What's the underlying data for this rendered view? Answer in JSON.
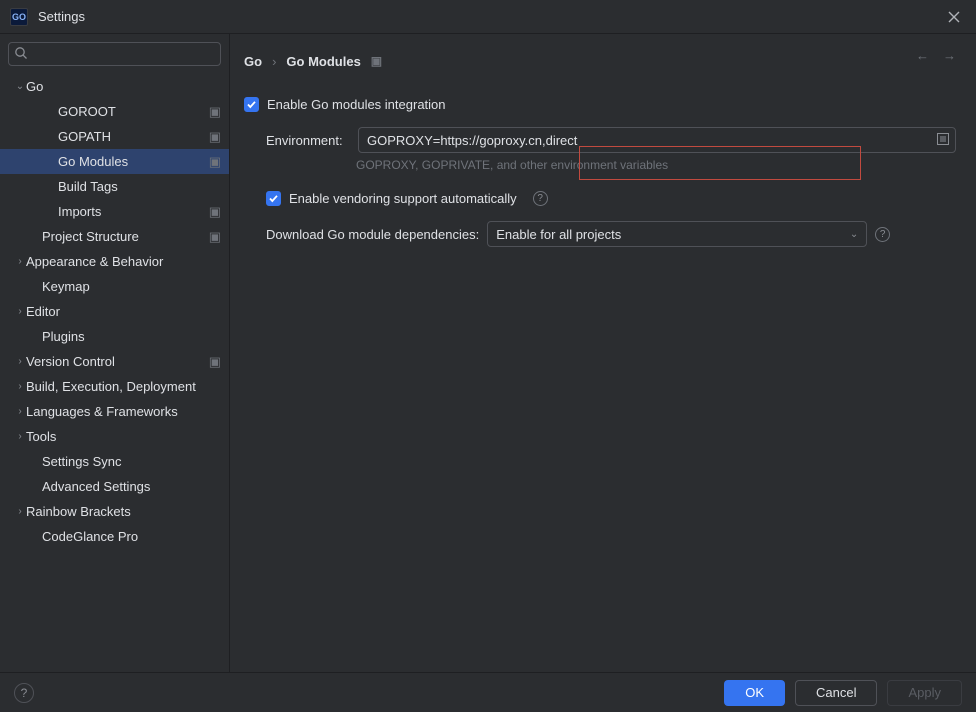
{
  "window": {
    "title": "Settings",
    "app_icon_text": "GO"
  },
  "search": {
    "placeholder": "",
    "value": ""
  },
  "sidebar": {
    "items": [
      {
        "label": "Go",
        "level": 0,
        "arrow": "down",
        "badge": false,
        "selected": false
      },
      {
        "label": "GOROOT",
        "level": 2,
        "arrow": "",
        "badge": true,
        "selected": false
      },
      {
        "label": "GOPATH",
        "level": 2,
        "arrow": "",
        "badge": true,
        "selected": false
      },
      {
        "label": "Go Modules",
        "level": 2,
        "arrow": "",
        "badge": true,
        "selected": true
      },
      {
        "label": "Build Tags",
        "level": 2,
        "arrow": "",
        "badge": false,
        "selected": false
      },
      {
        "label": "Imports",
        "level": 2,
        "arrow": "",
        "badge": true,
        "selected": false
      },
      {
        "label": "Project Structure",
        "level": 1,
        "arrow": "",
        "badge": true,
        "selected": false
      },
      {
        "label": "Appearance & Behavior",
        "level": 0,
        "arrow": "right",
        "badge": false,
        "selected": false
      },
      {
        "label": "Keymap",
        "level": 1,
        "arrow": "",
        "badge": false,
        "selected": false
      },
      {
        "label": "Editor",
        "level": 0,
        "arrow": "right",
        "badge": false,
        "selected": false
      },
      {
        "label": "Plugins",
        "level": 1,
        "arrow": "",
        "badge": false,
        "selected": false
      },
      {
        "label": "Version Control",
        "level": 0,
        "arrow": "right",
        "badge": true,
        "selected": false
      },
      {
        "label": "Build, Execution, Deployment",
        "level": 0,
        "arrow": "right",
        "badge": false,
        "selected": false
      },
      {
        "label": "Languages & Frameworks",
        "level": 0,
        "arrow": "right",
        "badge": false,
        "selected": false
      },
      {
        "label": "Tools",
        "level": 0,
        "arrow": "right",
        "badge": false,
        "selected": false
      },
      {
        "label": "Settings Sync",
        "level": 1,
        "arrow": "",
        "badge": false,
        "selected": false
      },
      {
        "label": "Advanced Settings",
        "level": 1,
        "arrow": "",
        "badge": false,
        "selected": false
      },
      {
        "label": "Rainbow Brackets",
        "level": 0,
        "arrow": "right",
        "badge": false,
        "selected": false
      },
      {
        "label": "CodeGlance Pro",
        "level": 1,
        "arrow": "",
        "badge": false,
        "selected": false
      }
    ]
  },
  "breadcrumb": {
    "root": "Go",
    "leaf": "Go Modules"
  },
  "form": {
    "enable_modules": {
      "checked": true,
      "label": "Enable Go modules integration"
    },
    "environment": {
      "label": "Environment:",
      "value": "GOPROXY=https://goproxy.cn,direct",
      "hint": "GOPROXY, GOPRIVATE, and other environment variables"
    },
    "enable_vendoring": {
      "checked": true,
      "label": "Enable vendoring support automatically"
    },
    "download": {
      "label": "Download Go module dependencies:",
      "selected": "Enable for all projects"
    }
  },
  "footer": {
    "ok": "OK",
    "cancel": "Cancel",
    "apply": "Apply"
  }
}
